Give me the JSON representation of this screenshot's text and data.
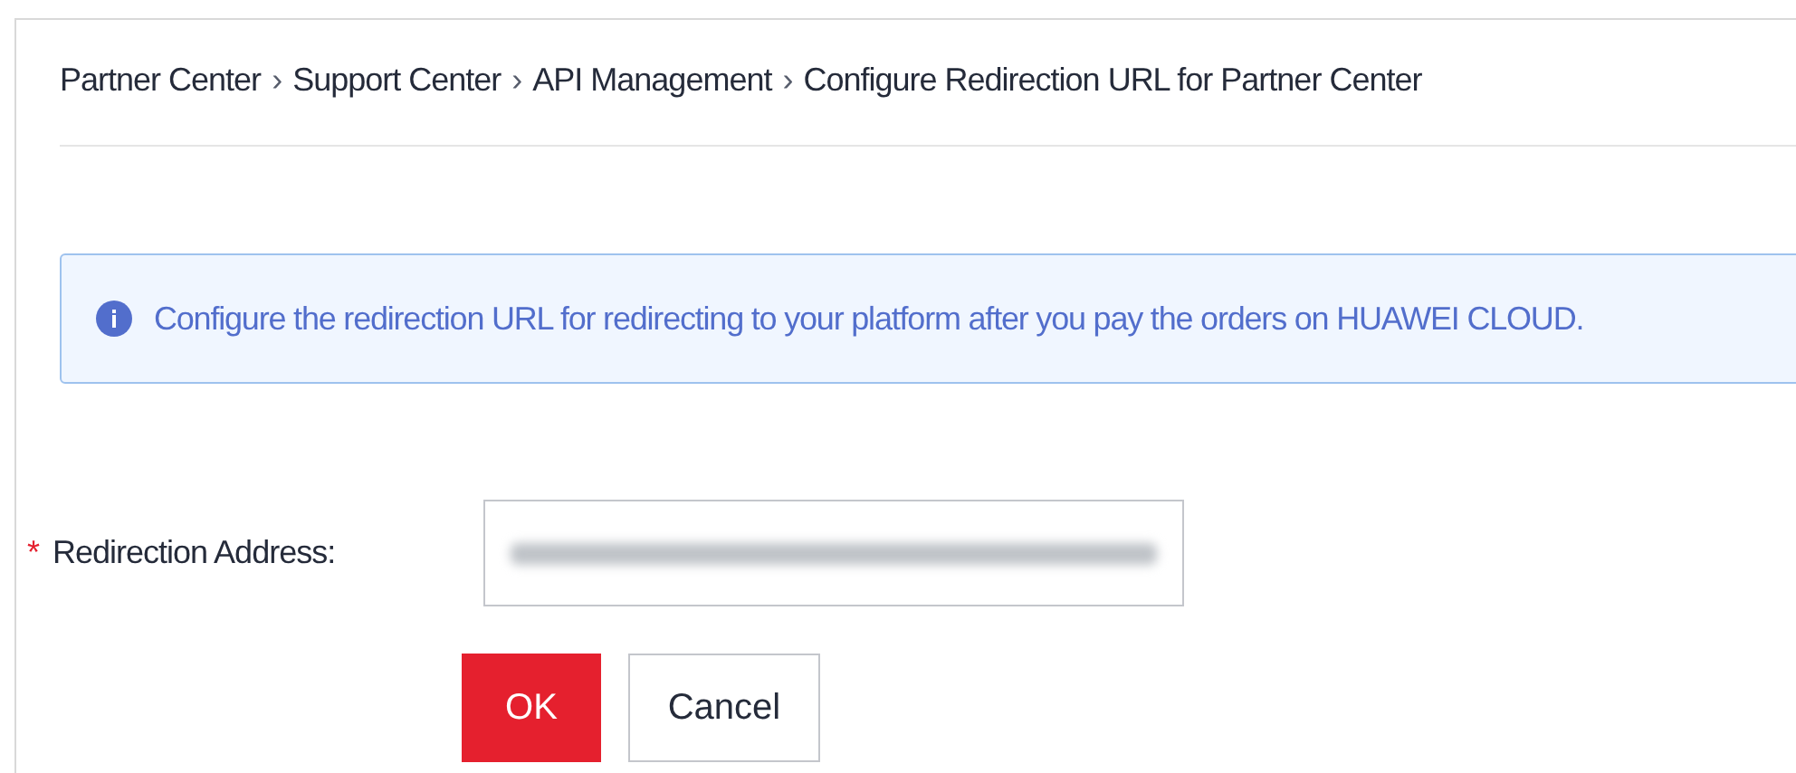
{
  "breadcrumb": [
    "Partner Center",
    "Support Center",
    "API Management",
    "Configure Redirection URL for Partner Center"
  ],
  "breadcrumb_separator": "›",
  "notice": {
    "text": "Configure the redirection URL for redirecting to your platform after you pay the orders on HUAWEI CLOUD."
  },
  "form": {
    "fields": [
      {
        "label": "Redirection Address:",
        "required": true,
        "required_mark": "*"
      }
    ]
  },
  "buttons": [
    {
      "label": "OK",
      "kind": "primary"
    },
    {
      "label": "Cancel",
      "kind": "secondary"
    }
  ]
}
